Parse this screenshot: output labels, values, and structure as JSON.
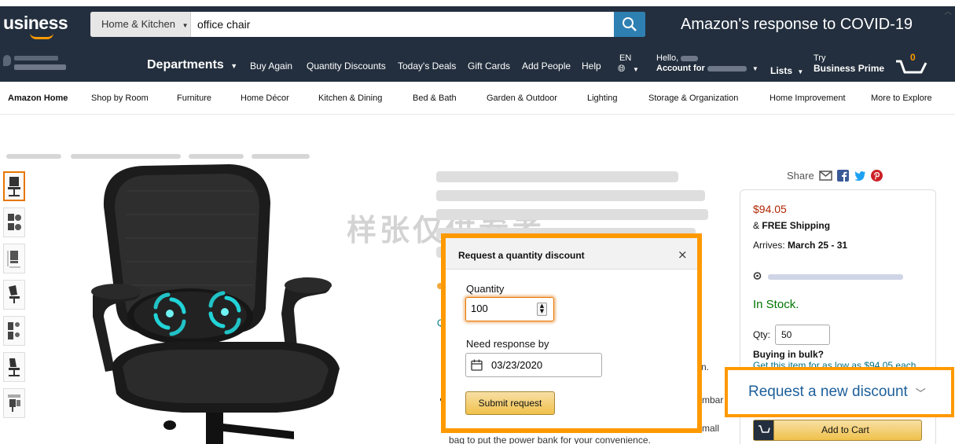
{
  "header": {
    "logo": "usiness",
    "search_category": "Home & Kitchen",
    "search_value": "office chair",
    "covid_link": "Amazon's response to COVID-19",
    "departments": "Departments",
    "nav_links": [
      "Buy Again",
      "Quantity Discounts",
      "Today's Deals",
      "Gift Cards",
      "Add People",
      "Help"
    ],
    "language": "EN",
    "hello": "Hello,",
    "account_for": "Account for",
    "lists": "Lists",
    "try": "Try",
    "business_prime": "Business Prime",
    "cart_count": "0"
  },
  "subnav": [
    "Amazon Home",
    "Shop by Room",
    "Furniture",
    "Home Décor",
    "Kitchen & Dining",
    "Bed & Bath",
    "Garden & Outdoor",
    "Lighting",
    "Storage & Organization",
    "Home Improvement",
    "More to Explore"
  ],
  "watermark": "样张仅供参考",
  "product": {
    "bullet_tail_1": "n.",
    "bullet_tail_2": "mbar",
    "bullet_tail_3": "mall",
    "bullet_line": "bag to put the power bank for your convenience."
  },
  "buybox": {
    "share": "Share",
    "price": "$94.05",
    "shipping_prefix": "&",
    "shipping": "FREE Shipping",
    "arrives_label": "Arrives:",
    "arrives_value": "March 25 - 31",
    "stock": "In Stock.",
    "qty_label": "Qty:",
    "qty_value": "50",
    "bulk_title": "Buying in bulk?",
    "bulk_sub": "Get this item for as low as $94.05 each",
    "add_to_cart": "Add to Cart"
  },
  "new_discount": "Request a new discount",
  "modal": {
    "title": "Request a quantity discount",
    "close": "×",
    "quantity_label": "Quantity",
    "quantity_value": "100",
    "response_label": "Need response by",
    "response_value": "03/23/2020",
    "submit": "Submit request"
  },
  "colors": {
    "nav_bg": "#232f3e",
    "highlight": "#ff9900",
    "price": "#b12704",
    "in_stock": "#007600",
    "link": "#1d5f9a"
  }
}
